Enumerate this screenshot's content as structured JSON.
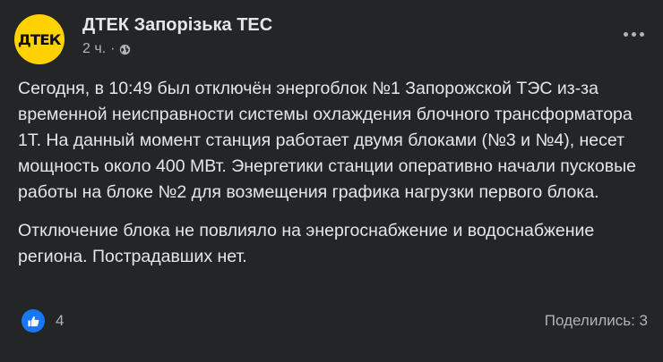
{
  "post": {
    "author": "ДТЕК Запорізька ТЕС",
    "avatar_text": "ДТЕК",
    "time": "2 ч.",
    "dot": "·",
    "paragraphs": [
      "Сегодня, в 10:49 был отключён энергоблок №1 Запорожской ТЭС из-за временной  неисправности системы охлаждения блочного трансформатора 1Т. На данный момент станция работает двумя блоками (№3 и №4), несет мощность около 400 МВт. Энергетики станции оперативно начали пусковые работы на блоке №2 для возмещения графика нагрузки первого блока.",
      "Отключение блока не повлияло на энергоснабжение и водоснабжение региона. Пострадавших нет."
    ],
    "likes": "4",
    "shares": "Поделились: 3"
  },
  "icons": {
    "privacy": "globe-icon",
    "menu": "more-horizontal-icon",
    "reaction": "like-icon"
  },
  "colors": {
    "background": "#242526",
    "text_primary": "#e4e6eb",
    "text_secondary": "#b0b3b8",
    "like_blue": "#1877f2",
    "brand_yellow": "#ffd200"
  }
}
